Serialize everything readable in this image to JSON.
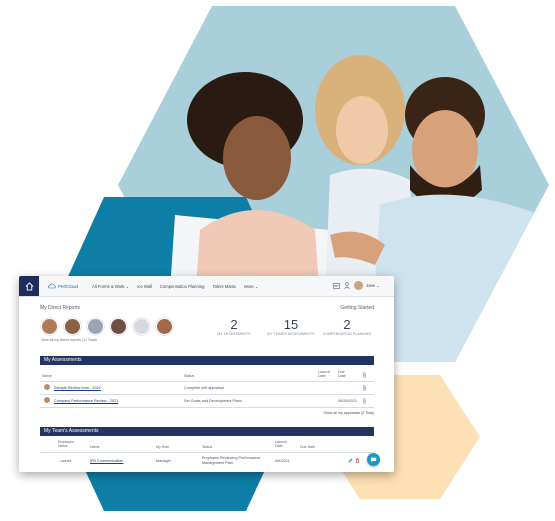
{
  "colors": {
    "hex_blue_light": "#a9cfdb",
    "hex_blue_dark": "#0f7ea6",
    "hex_peach": "#fde0b4",
    "brand_navy": "#24335f",
    "accent_blue": "#1c97c4"
  },
  "app": {
    "logo_text": "PerfCloud",
    "nav": [
      "All Forms & Work ⌄",
      "Ice Wall",
      "Compensation Planning",
      "Talent Matrix",
      "More ⌄"
    ],
    "user_name": "Jane ⌄"
  },
  "direct_reports": {
    "title": "My Direct Reports",
    "view_all": "View all my direct reports (11 Total)"
  },
  "getting_started": {
    "title": "Getting Started"
  },
  "stats": [
    {
      "value": "2",
      "label": "MY ASSESSMENTS"
    },
    {
      "value": "15",
      "label": "MY TEAM'S ASSESSMENTS"
    },
    {
      "value": "2",
      "label": "COMPENSATION PLANNING"
    }
  ],
  "my_assessments": {
    "title": "My Assessments",
    "headers": {
      "name": "Name",
      "status": "Status",
      "launch": "Launch Date",
      "due": "Due Date"
    },
    "rows": [
      {
        "name": "Sample Review form - 2021",
        "status": "Complete self appraisal",
        "launch": "",
        "due": ""
      },
      {
        "name": "Company Performance Review - 2021",
        "status": "Set Goals and Development Plans",
        "launch": "",
        "due": "09/29/2021"
      }
    ],
    "show_all": "Show all my appraisals (2 Total)"
  },
  "team_assessments": {
    "title": "My Team's Assessments",
    "headers": {
      "employee": "Employee Name",
      "name": "Name",
      "role": "My Role",
      "status": "Status",
      "launch": "Launch Date",
      "due": "Due Date"
    },
    "rows": [
      {
        "employee": "...onnell",
        "name": "IFB Communication",
        "role": "Manager",
        "status": "Employee Reviewing Performance Management Plan",
        "launch": "4/6/2021",
        "due": ""
      }
    ]
  }
}
